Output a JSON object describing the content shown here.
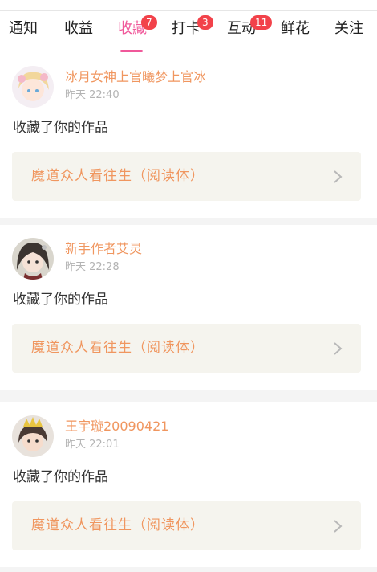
{
  "tabs": [
    {
      "label": "通知",
      "badge": null
    },
    {
      "label": "收益",
      "badge": null
    },
    {
      "label": "收藏",
      "badge": "7",
      "active": true
    },
    {
      "label": "打卡",
      "badge": "3"
    },
    {
      "label": "互动",
      "badge": "11"
    },
    {
      "label": "鲜花",
      "badge": null
    },
    {
      "label": "关注",
      "badge": null
    }
  ],
  "colors": {
    "accent": "#f0589a",
    "badge": "#f2424a",
    "name": "#f0965f",
    "time": "#b3b3b3",
    "work_bg": "#f5f4ee"
  },
  "notifications": [
    {
      "username": "冰月女神上官曦梦上官冰",
      "time": "昨天 22:40",
      "action": "收藏了你的作品",
      "work_title": "魔道众人看往生（阅读体）"
    },
    {
      "username": "新手作者艾灵",
      "time": "昨天 22:28",
      "action": "收藏了你的作品",
      "work_title": "魔道众人看往生（阅读体）"
    },
    {
      "username": "王宇璇20090421",
      "time": "昨天 22:01",
      "action": "收藏了你的作品",
      "work_title": "魔道众人看往生（阅读体）"
    }
  ]
}
